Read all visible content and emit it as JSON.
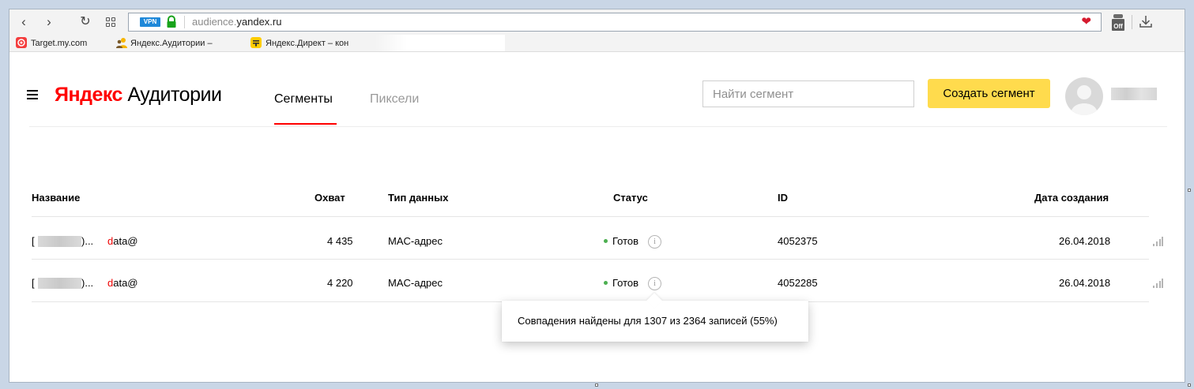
{
  "browser": {
    "address_badge": "VPN",
    "url_light": "audience.",
    "url_host": "yandex.ru",
    "bookmarks": [
      {
        "label": "Target.my.com",
        "icon": "target-icon",
        "color": "#f43d3d"
      },
      {
        "label": "Яндекс.Аудитории –",
        "icon": "audience-icon",
        "color": "#f7b500"
      },
      {
        "label": "Яндекс.Директ – кон",
        "icon": "direct-icon",
        "color": "#ffcc00"
      }
    ],
    "extension_badge": "Off"
  },
  "header": {
    "logo_brand": "Яндекс",
    "logo_product": "Аудитории",
    "tabs": [
      {
        "label": "Сегменты",
        "active": true
      },
      {
        "label": "Пиксели",
        "active": false
      }
    ],
    "search_placeholder": "Найти сегмент",
    "create_button": "Создать сегмент"
  },
  "table": {
    "columns": [
      "Название",
      "Охват",
      "Тип данных",
      "Статус",
      "ID",
      "Дата создания"
    ],
    "rows": [
      {
        "name_prefix": "[",
        "name_mid": ")...",
        "name_red": "d",
        "name_rest": "ata@",
        "reach": "4 435",
        "data_type": "MAC-адрес",
        "status": "Готов",
        "id": "4052375",
        "date": "26.04.2018"
      },
      {
        "name_prefix": "[",
        "name_mid": ")...",
        "name_red": "d",
        "name_rest": "ata@",
        "reach": "4 220",
        "data_type": "MAC-адрес",
        "status": "Готов",
        "id": "4052285",
        "date": "26.04.2018"
      }
    ]
  },
  "tooltip": {
    "text": "Совпадения найдены для 1307 из 2364 записей (55%)"
  },
  "colors": {
    "accent_red": "#ff0000",
    "button_yellow": "#ffdb4d",
    "status_green": "#4caf50"
  }
}
